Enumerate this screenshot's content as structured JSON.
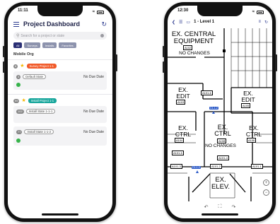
{
  "phone1": {
    "time": "11:11",
    "header": {
      "title": "Project Dashboard"
    },
    "search": {
      "placeholder": "Search for a project or state"
    },
    "filters": [
      "All",
      "Surveys",
      "Installs",
      "Favorites"
    ],
    "org": "Mobile Org",
    "projects": [
      {
        "count": "8",
        "tag": "Survey Project 1-1",
        "tag_color": "#f15a29",
        "states": [
          {
            "count": "3",
            "name": "Default State",
            "due": "No Due Date"
          }
        ]
      },
      {
        "count": "99",
        "tag": "Install Project 1-1",
        "tag_color": "#1aa79d",
        "states": [
          {
            "count": "102",
            "name": "Install State 1-1-1",
            "due": "No Due Date"
          },
          {
            "count": "77",
            "name": "Install State 1-1-2",
            "due": "No Due Date"
          }
        ]
      }
    ]
  },
  "phone2": {
    "time": "12:30",
    "nav": {
      "title": "1 - Level 1"
    },
    "plan": {
      "room_equipment": [
        "EX. CENTRAL",
        "EQUIPMENT"
      ],
      "room_equipment_tag": "A102",
      "no_changes": "NO CHANGES",
      "room_edit_left": [
        "EX.",
        "EDIT"
      ],
      "room_edit_left_tag": "A103",
      "room_edit_right": [
        "EX.",
        "EDIT"
      ],
      "room_edit_right_tag": "A105",
      "room_ctrl_left": [
        "EX.",
        "CTRL"
      ],
      "room_ctrl_left_tag": "A104",
      "room_ctrl_mid": [
        "EX.",
        "CTRL"
      ],
      "room_ctrl_mid_tag": "A108",
      "room_ctrl_right": [
        "EX.",
        "CTRL"
      ],
      "room_ctrl_right_tag": "A106",
      "no_changes_2": "NO CHANGES",
      "room_elev": [
        "EX.",
        "ELEV."
      ],
      "tags": [
        "A101-6",
        "A101-5",
        "A101-4",
        "A101-3",
        "A101-2",
        "A101-1"
      ],
      "pins": [
        "C1-1-2",
        "C1-1-3"
      ]
    }
  }
}
